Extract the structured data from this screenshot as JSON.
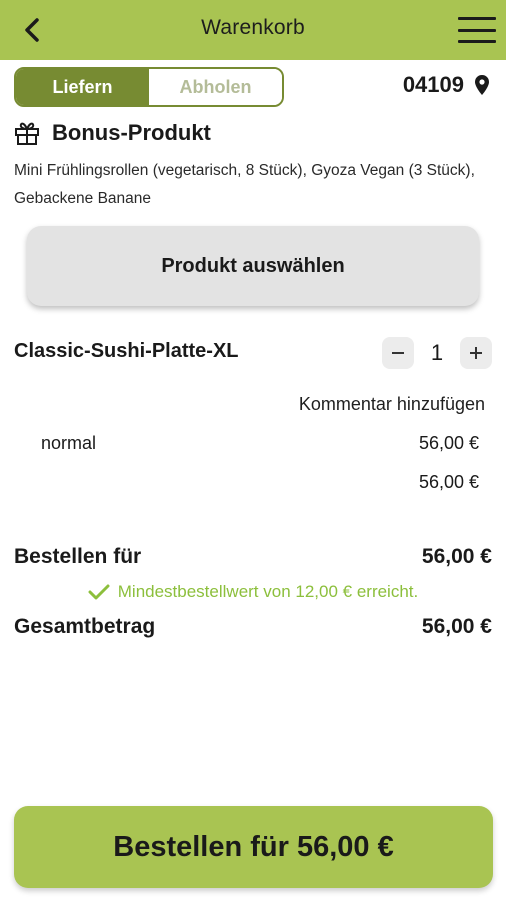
{
  "header": {
    "title": "Warenkorb",
    "back_icon": "chevron-left-icon",
    "menu_icon": "hamburger-menu-icon",
    "bg_color": "#a9c452"
  },
  "delivery_toggle": {
    "options": [
      "Liefern",
      "Abholen"
    ],
    "selected": "Liefern",
    "active_color": "#778b32"
  },
  "location": {
    "zip": "04109",
    "icon": "location-pin-icon"
  },
  "bonus": {
    "icon": "gift-icon",
    "title": "Bonus-Produkt",
    "description": "Mini Frühlingsrollen (vegetarisch, 8 Stück), Gyoza Vegan (3 Stück), Gebackene Banane",
    "select_label": "Produkt auswählen"
  },
  "cart": {
    "items": [
      {
        "name": "Classic-Sushi-Platte-XL",
        "quantity": "1",
        "comment_label": "Kommentar hinzufügen",
        "variant": "normal",
        "variant_price": "56,00 €",
        "subtotal": "56,00 €"
      }
    ]
  },
  "summary": {
    "order_label": "Bestellen für",
    "order_value": "56,00 €",
    "min_order_note": "Mindestbestellwert von 12,00 € erreicht.",
    "min_order_color": "#8cbf3c",
    "total_label": "Gesamtbetrag",
    "total_value": "56,00 €"
  },
  "checkout": {
    "label": "Bestellen für 56,00 €"
  }
}
